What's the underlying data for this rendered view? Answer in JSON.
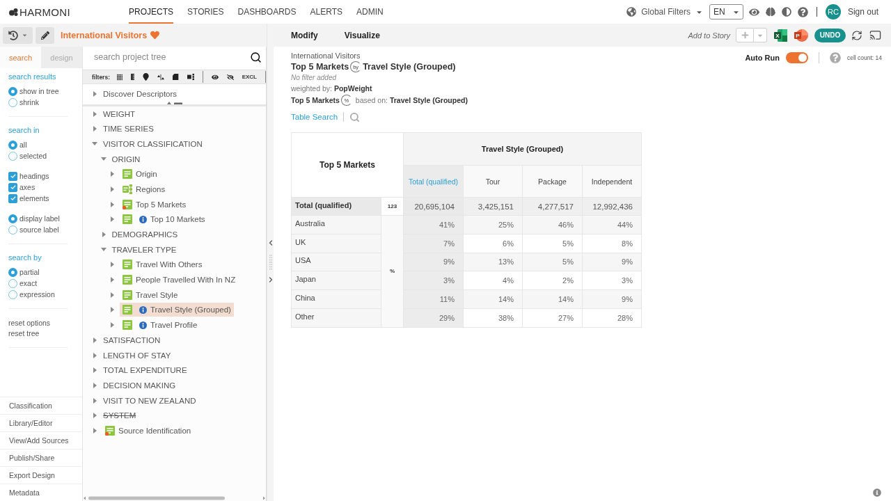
{
  "top_nav": {
    "logo": "HARMONI",
    "menu": [
      {
        "label": "PROJECTS",
        "selected": true
      },
      {
        "label": "STORIES",
        "selected": false
      },
      {
        "label": "DASHBOARDS",
        "selected": false
      },
      {
        "label": "ALERTS",
        "selected": false
      },
      {
        "label": "ADMIN",
        "selected": false
      }
    ],
    "global_filters": "Global Filters",
    "language": "EN",
    "avatar": "RC",
    "sign_out": "Sign out"
  },
  "project_bar": {
    "title": "International Visitors",
    "favorite": true
  },
  "action_bar": {
    "modes": [
      "Modify",
      "Visualize"
    ],
    "add_to_story": "Add to Story",
    "exports": [
      {
        "kind": "excel",
        "letter": "X"
      },
      {
        "kind": "powerpoint",
        "letter": "P"
      }
    ],
    "undo": "UNDO"
  },
  "sidebar": {
    "tabs": [
      {
        "label": "search",
        "selected": true
      },
      {
        "label": "design",
        "selected": false
      }
    ],
    "sections": [
      {
        "heading": "search results",
        "groups": [
          [
            {
              "kind": "radio",
              "label": "show in tree",
              "selected": true
            },
            {
              "kind": "radio",
              "label": "shrink",
              "selected": false
            }
          ]
        ]
      },
      {
        "heading": "search in",
        "groups": [
          [
            {
              "kind": "radio",
              "label": "all",
              "selected": true
            },
            {
              "kind": "radio",
              "label": "selected",
              "selected": false
            }
          ],
          [
            {
              "kind": "checkbox",
              "label": "headings",
              "checked": true
            },
            {
              "kind": "checkbox",
              "label": "axes",
              "checked": true
            },
            {
              "kind": "checkbox",
              "label": "elements",
              "checked": true
            }
          ],
          [
            {
              "kind": "radio",
              "label": "display label",
              "selected": true
            },
            {
              "kind": "radio",
              "label": "source label",
              "selected": false
            }
          ]
        ]
      },
      {
        "heading": "search by",
        "groups": [
          [
            {
              "kind": "radio",
              "label": "partial",
              "selected": true
            },
            {
              "kind": "radio",
              "label": "exact",
              "selected": false
            },
            {
              "kind": "radio",
              "label": "expression",
              "selected": false
            }
          ]
        ]
      },
      {
        "links": [
          "reset options",
          "reset tree"
        ]
      }
    ],
    "links": [
      "Classification",
      "Library/Editor",
      "View/Add Sources",
      "Publish/Share",
      "Export Design",
      "Metadata"
    ]
  },
  "tree_panel": {
    "search_placeholder": "search project tree",
    "filters_label": "filters:",
    "exclude_label": "EXCL",
    "pinned": [
      {
        "label": "Discover Descriptors",
        "kind": "folder",
        "expanded": false,
        "selected": false,
        "info": false,
        "flagged": false,
        "excluded": false
      }
    ],
    "items": [
      {
        "label": "WEIGHT",
        "kind": "folder",
        "expanded": false,
        "selected": false,
        "info": false,
        "flagged": false,
        "excluded": false
      },
      {
        "label": "TIME SERIES",
        "kind": "folder",
        "expanded": false,
        "selected": false,
        "info": false,
        "flagged": false,
        "excluded": false
      },
      {
        "label": "VISITOR CLASSIFICATION",
        "kind": "folder",
        "expanded": true,
        "selected": false,
        "info": false,
        "flagged": false,
        "excluded": false,
        "children": [
          {
            "label": "ORIGIN",
            "kind": "folder",
            "expanded": true,
            "selected": false,
            "info": false,
            "flagged": false,
            "excluded": false,
            "children": [
              {
                "label": "Origin",
                "kind": "variable",
                "expanded": false,
                "selected": false,
                "info": false,
                "flagged": false,
                "excluded": false
              },
              {
                "label": "Regions",
                "kind": "grouped",
                "expanded": false,
                "selected": false,
                "info": false,
                "flagged": false,
                "excluded": false
              },
              {
                "label": "Top 5 Markets",
                "kind": "variable",
                "expanded": false,
                "selected": false,
                "info": false,
                "flagged": true,
                "excluded": false
              },
              {
                "label": "Top 10 Markets",
                "kind": "variable",
                "expanded": false,
                "selected": false,
                "info": true,
                "flagged": false,
                "excluded": false
              }
            ]
          },
          {
            "label": "DEMOGRAPHICS",
            "kind": "folder",
            "expanded": false,
            "selected": false,
            "info": false,
            "flagged": false,
            "excluded": false
          },
          {
            "label": "TRAVELER TYPE",
            "kind": "folder",
            "expanded": true,
            "selected": false,
            "info": false,
            "flagged": false,
            "excluded": false,
            "children": [
              {
                "label": "Travel With Others",
                "kind": "variable",
                "expanded": false,
                "selected": false,
                "info": false,
                "flagged": false,
                "excluded": false
              },
              {
                "label": "People Travelled With In NZ",
                "kind": "variable",
                "expanded": false,
                "selected": false,
                "info": false,
                "flagged": false,
                "excluded": false
              },
              {
                "label": "Travel Style",
                "kind": "variable",
                "expanded": false,
                "selected": false,
                "info": false,
                "flagged": false,
                "excluded": false
              },
              {
                "label": "Travel Style (Grouped)",
                "kind": "variable",
                "expanded": false,
                "selected": true,
                "info": true,
                "flagged": false,
                "excluded": false
              },
              {
                "label": "Travel Profile",
                "kind": "variable",
                "expanded": false,
                "selected": false,
                "info": true,
                "flagged": false,
                "excluded": false
              }
            ]
          }
        ]
      },
      {
        "label": "SATISFACTION",
        "kind": "folder",
        "expanded": false,
        "selected": false,
        "info": false,
        "flagged": false,
        "excluded": false
      },
      {
        "label": "LENGTH OF STAY",
        "kind": "folder",
        "expanded": false,
        "selected": false,
        "info": false,
        "flagged": false,
        "excluded": false
      },
      {
        "label": "TOTAL EXPENDITURE",
        "kind": "folder",
        "expanded": false,
        "selected": false,
        "info": false,
        "flagged": false,
        "excluded": false
      },
      {
        "label": "DECISION MAKING",
        "kind": "folder",
        "expanded": false,
        "selected": false,
        "info": false,
        "flagged": false,
        "excluded": false
      },
      {
        "label": "VISIT TO NEW ZEALAND",
        "kind": "folder",
        "expanded": false,
        "selected": false,
        "info": false,
        "flagged": false,
        "excluded": false
      },
      {
        "label": "SYSTEM",
        "kind": "folder",
        "expanded": false,
        "selected": false,
        "info": false,
        "flagged": false,
        "excluded": true
      },
      {
        "label": "Source Identification",
        "kind": "variable",
        "expanded": false,
        "selected": false,
        "info": false,
        "flagged": true,
        "excluded": false
      }
    ]
  },
  "report": {
    "project": "International Visitors",
    "title": {
      "rows": "Top 5 Markets",
      "join": "by",
      "columns": "Travel Style (Grouped)"
    },
    "filter_note": "No filter added",
    "weighting": "weighted by: **PopWeight**",
    "percentage": {
      "base": "Top 5 Markets",
      "symbol": "%",
      "based_on": "based on: **Travel Style (Grouped)**"
    },
    "table_search": "Table Search",
    "auto_run": {
      "label": "Auto Run",
      "on": true
    },
    "cell_count": "cell count: 14"
  },
  "table": {
    "corner": "Top 5 Markets",
    "column_group": "Travel Style (Grouped)",
    "columns": [
      {
        "label": "Total (qualified)",
        "kind": "total"
      },
      {
        "label": "Tour",
        "kind": "category"
      },
      {
        "label": "Package",
        "kind": "category"
      },
      {
        "label": "Independent",
        "kind": "category"
      }
    ],
    "total_row": {
      "label": "Total (qualified)",
      "stat": "123",
      "values": [
        "20,695,104",
        "3,425,151",
        "4,277,517",
        "12,992,436"
      ]
    },
    "stat_label": "%",
    "rows": [
      {
        "label": "Australia",
        "values": [
          "41%",
          "25%",
          "46%",
          "44%"
        ]
      },
      {
        "label": "UK",
        "values": [
          "7%",
          "6%",
          "5%",
          "8%"
        ]
      },
      {
        "label": "USA",
        "values": [
          "9%",
          "13%",
          "5%",
          "9%"
        ]
      },
      {
        "label": "Japan",
        "values": [
          "3%",
          "4%",
          "2%",
          "3%"
        ]
      },
      {
        "label": "China",
        "values": [
          "11%",
          "14%",
          "14%",
          "9%"
        ]
      },
      {
        "label": "Other",
        "values": [
          "29%",
          "38%",
          "27%",
          "28%"
        ]
      }
    ]
  }
}
